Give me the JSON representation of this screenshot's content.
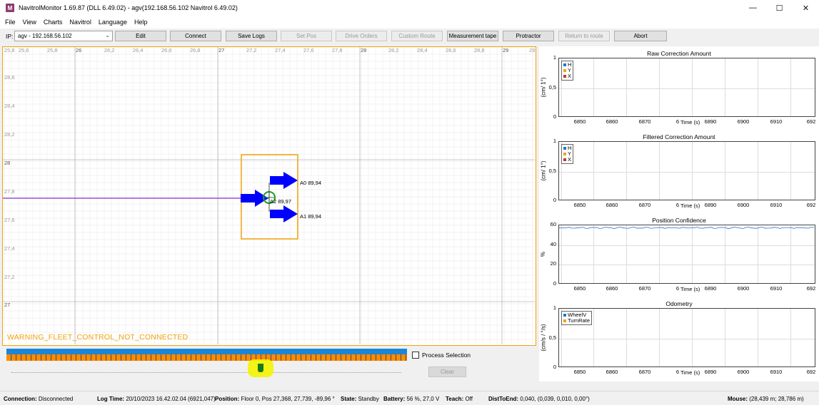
{
  "window": {
    "app_icon": "M",
    "title": "NavitrolMonitor 1.69.87 (DLL 6.49.02) - agv(192.168.56.102 Navitrol 6.49.02)",
    "minimize": "—",
    "maximize": "☐",
    "close": "✕"
  },
  "menu": [
    "File",
    "View",
    "Charts",
    "Navitrol",
    "Language",
    "Help"
  ],
  "toolbar": {
    "ip_label": "IP:",
    "ip_value": "agv - 192.168.56.102",
    "buttons": [
      {
        "label": "Edit",
        "enabled": true
      },
      {
        "label": "Connect",
        "enabled": true
      },
      {
        "label": "Save Logs",
        "enabled": true
      },
      {
        "label": "Set Pos",
        "enabled": false
      },
      {
        "label": "Drive Orders",
        "enabled": false
      },
      {
        "label": "Custom Route",
        "enabled": false
      },
      {
        "label": "Measurement tape",
        "enabled": true
      },
      {
        "label": "Protractor",
        "enabled": true
      },
      {
        "label": "Return to route",
        "enabled": false
      },
      {
        "label": "Abort",
        "enabled": true
      }
    ]
  },
  "map": {
    "x_ticks_major": [
      "26",
      "27",
      "28",
      "29"
    ],
    "x_ticks_minor": [
      "25,6",
      "25,8",
      "26,2",
      "26,4",
      "26,6",
      "26,8",
      "27,2",
      "27,4",
      "27,6",
      "27,8",
      "28,2",
      "28,4",
      "28,6",
      "28,8"
    ],
    "x_tick_edge_left": "25,8",
    "x_tick_edge_right": "29",
    "y_ticks": [
      "28,6",
      "28,4",
      "28,2",
      "28",
      "27,8",
      "27,6",
      "27,4",
      "27,2",
      "27"
    ],
    "y_tick_top": "28,8",
    "antennas": [
      {
        "label": "A0 89,94"
      },
      {
        "label": "A2 89,97"
      },
      {
        "label": "A1 89,94"
      }
    ],
    "warning": "WARNING_FLEET_CONTROL_NOT_CONNECTED",
    "colors": {
      "frame": "#f0a30a",
      "arrow": "#0000ff",
      "path": "#8b2bd6",
      "marker": "#2aa02a"
    }
  },
  "timeline": {
    "process_selection_label": "Process Selection",
    "process_selection_checked": false,
    "clear_label": "Clear",
    "thumb_position": 0.64
  },
  "charts": [
    {
      "title": "Raw Correction Amount",
      "ylabel": "(cm/ 1°)",
      "yticks": [
        "1",
        "0,5",
        "0"
      ],
      "xticks": [
        "6850",
        "6860",
        "6870",
        "6​",
        "6890",
        "6900",
        "6910",
        "692"
      ],
      "xlabel": "Time (s)",
      "legend": [
        {
          "name": "H",
          "color": "#1f77d0"
        },
        {
          "name": "Y",
          "color": "#f0a30a"
        },
        {
          "name": "X",
          "color": "#c0392b"
        }
      ]
    },
    {
      "title": "Filtered Correction Amount",
      "ylabel": "(cm/ 1°)",
      "yticks": [
        "1",
        "0,5",
        "0"
      ],
      "xticks": [
        "6850",
        "6860",
        "6870",
        "6​",
        "6890",
        "6900",
        "6910",
        "692"
      ],
      "xlabel": "Time (s)",
      "legend": [
        {
          "name": "H",
          "color": "#1f77d0"
        },
        {
          "name": "Y",
          "color": "#f0a30a"
        },
        {
          "name": "X",
          "color": "#c0392b"
        }
      ]
    },
    {
      "title": "Position Confidence",
      "ylabel": "%",
      "yticks": [
        "60",
        "40",
        "20",
        "0"
      ],
      "xticks": [
        "6850",
        "6860",
        "6870",
        "6​",
        "6890",
        "6900",
        "6910",
        "692"
      ],
      "xlabel": "Time (s)",
      "legend": []
    },
    {
      "title": "Odometry",
      "ylabel": "(cm/s / °/s)",
      "yticks": [
        "1",
        "0,5",
        "0"
      ],
      "xticks": [
        "6850",
        "6860",
        "6870",
        "6​",
        "6890",
        "6900",
        "6910",
        "692"
      ],
      "xlabel": "Time (s)",
      "legend": [
        {
          "name": "WheelV",
          "color": "#1f77d0"
        },
        {
          "name": "TurnRate",
          "color": "#f0a30a"
        }
      ]
    }
  ],
  "status": {
    "connection_label": "Connection:",
    "connection_value": "Disconnected",
    "logtime_label": "Log Time:",
    "logtime_value": "20/10/2023 16.42.02.04 (6921,047)",
    "position_label": "Position:",
    "position_value": "Floor 0, Pos 27,368, 27,739, -89,96 °",
    "state_label": "State:",
    "state_value": "Standby",
    "battery_label": "Battery:",
    "battery_value": "56 %, 27,0 V",
    "teach_label": "Teach:",
    "teach_value": "Off",
    "disttoend_label": "DistToEnd:",
    "disttoend_value": "0,040, (0,039, 0,010, 0,00°)",
    "mouse_label": "Mouse:",
    "mouse_value": "(28,439 m; 28,786 m)"
  }
}
